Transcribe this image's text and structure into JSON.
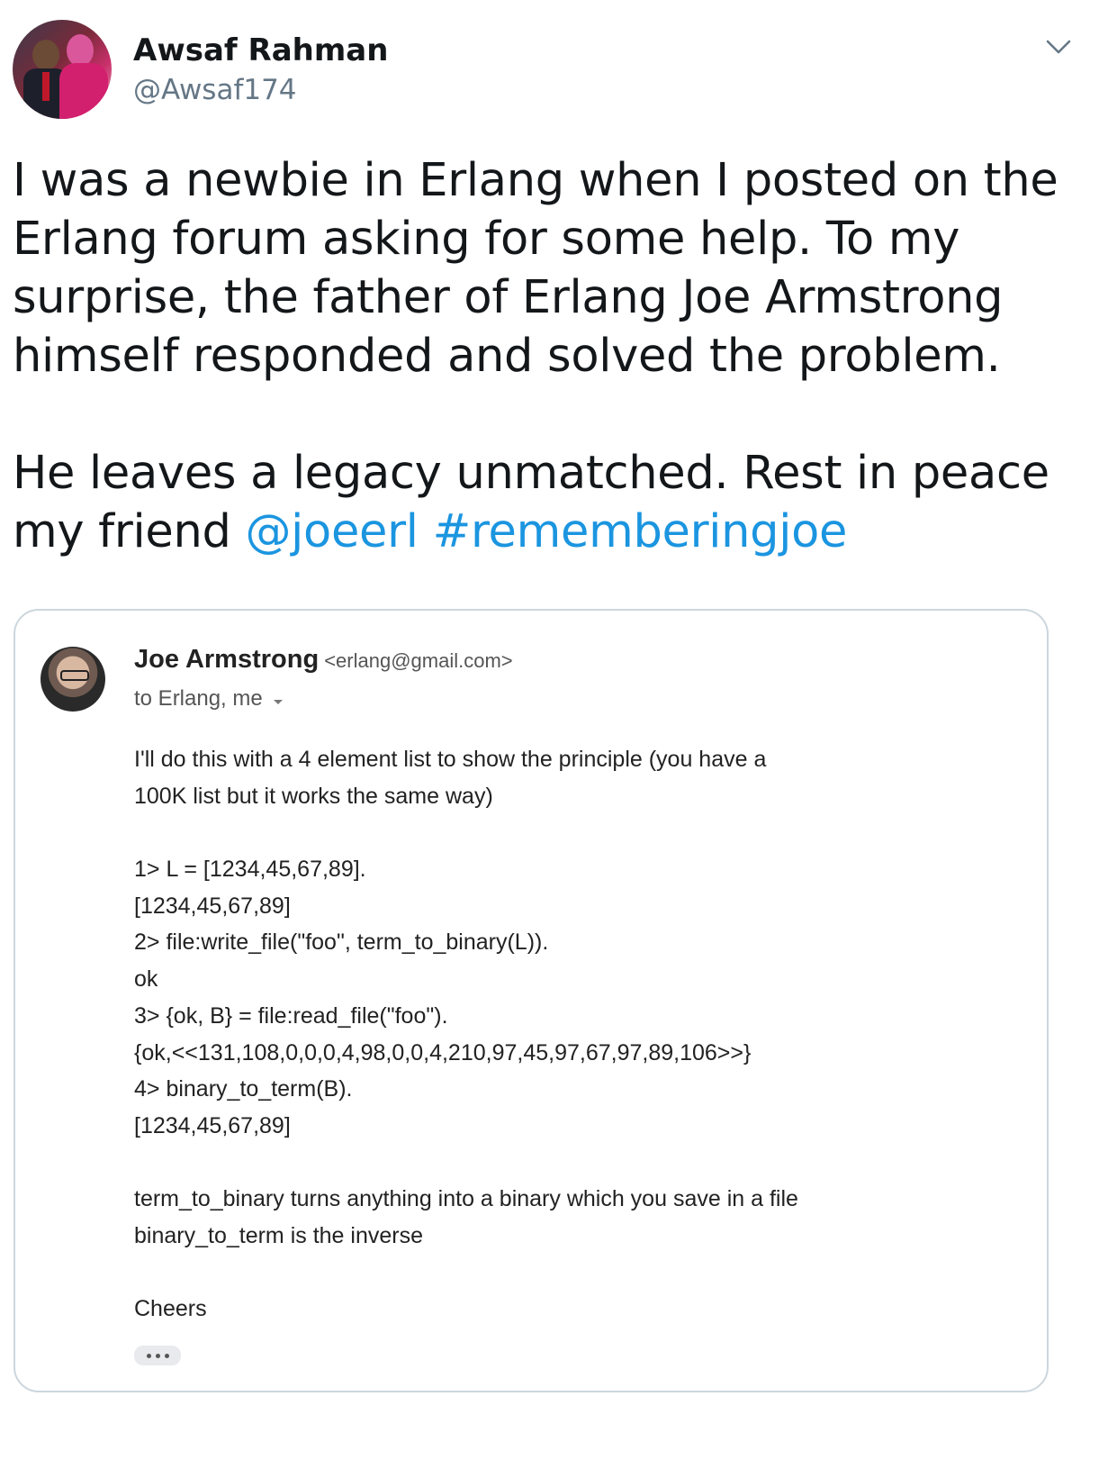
{
  "tweet": {
    "author": {
      "display_name": "Awsaf Rahman",
      "handle": "@Awsaf174"
    },
    "text": {
      "paragraph1": "I was a newbie in Erlang when I posted on the Erlang forum asking for some help. To my surprise, the father of Erlang Joe Armstrong himself responded and solved the problem.",
      "paragraph2_prefix": "He leaves a legacy unmatched. Rest in peace my friend",
      "mention": "@joeerl",
      "hashtag": "#rememberingjoe"
    },
    "icons": {
      "more_menu": "chevron-down-icon"
    },
    "colors": {
      "link": "#1b95e0",
      "handle": "#657786",
      "border": "#ccd6dd"
    }
  },
  "email": {
    "sender_name": "Joe Armstrong",
    "sender_email": "<erlang@gmail.com>",
    "recipients": "to Erlang, me",
    "body_lines": [
      "I'll do this with a 4 element list to show the principle (you have a",
      "100K list but it works the same way)",
      "",
      "1> L = [1234,45,67,89].",
      "[1234,45,67,89]",
      "2> file:write_file(\"foo\", term_to_binary(L)).",
      "ok",
      "3> {ok, B} = file:read_file(\"foo\").",
      "{ok,<<131,108,0,0,0,4,98,0,0,4,210,97,45,97,67,97,89,106>>}",
      "4> binary_to_term(B).",
      "[1234,45,67,89]",
      "",
      "term_to_binary turns anything into a binary which you save in a file",
      "binary_to_term is the inverse",
      "",
      "Cheers"
    ]
  }
}
